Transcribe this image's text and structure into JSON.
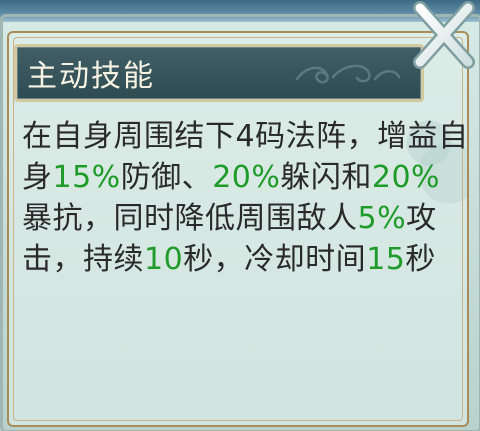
{
  "dialog": {
    "title": "主动技能",
    "description_segments": [
      {
        "text": "在自身周围结下4码法阵，增益自身",
        "highlight": false
      },
      {
        "text": "15%",
        "highlight": true
      },
      {
        "text": "防御、",
        "highlight": false
      },
      {
        "text": "20%",
        "highlight": true
      },
      {
        "text": "躲闪和",
        "highlight": false
      },
      {
        "text": "20%",
        "highlight": true
      },
      {
        "text": "暴抗，同时降低周围敌人",
        "highlight": false
      },
      {
        "text": "5%",
        "highlight": true
      },
      {
        "text": "攻击，持续",
        "highlight": false
      },
      {
        "text": "10",
        "highlight": true
      },
      {
        "text": "秒，冷却时间",
        "highlight": false
      },
      {
        "text": "15",
        "highlight": true
      },
      {
        "text": "秒",
        "highlight": false
      }
    ]
  },
  "icons": {
    "close": "close-x-icon",
    "decoration": "cloud-swirl-icon"
  },
  "colors": {
    "title_bg": "#36545b",
    "highlight": "#1f9b2a",
    "text": "#2a2a2a",
    "panel_border": "#a88d5a",
    "close_icon": "#f2f6f6"
  }
}
